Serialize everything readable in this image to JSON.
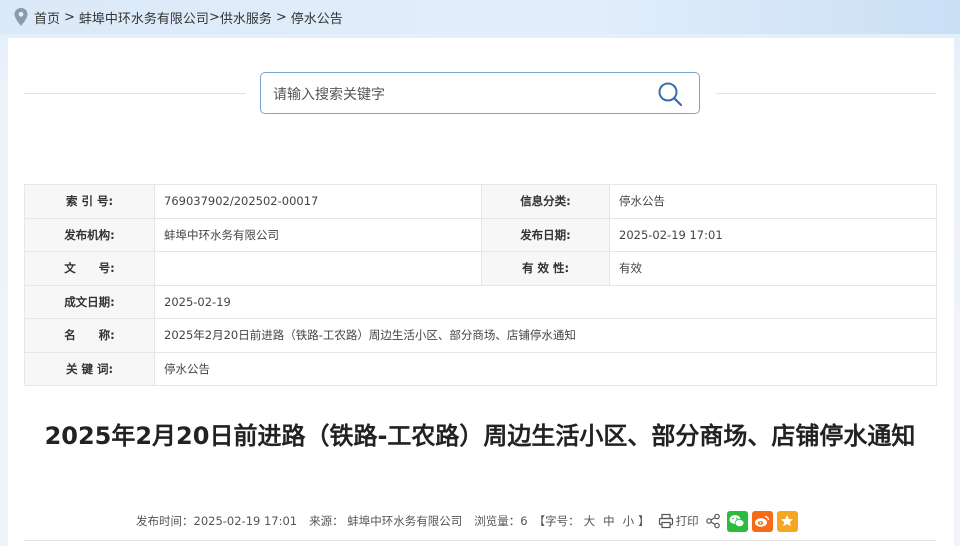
{
  "breadcrumb": {
    "items": [
      "首页",
      "蚌埠中环水务有限公司",
      "供水服务",
      "停水公告"
    ],
    "separators": [
      " > ",
      ">",
      " > "
    ]
  },
  "search": {
    "placeholder": "请输入搜索关键字",
    "value": ""
  },
  "meta_table": {
    "rows": [
      {
        "label1": "索 引 号:",
        "value1": "769037902/202502-00017",
        "label2": "信息分类:",
        "value2": "停水公告"
      },
      {
        "label1": "发布机构:",
        "value1": "蚌埠中环水务有限公司",
        "label2": "发布日期:",
        "value2": "2025-02-19 17:01"
      },
      {
        "label1": "文　　号:",
        "value1": "",
        "label2": "有 效 性:",
        "value2": "有效"
      },
      {
        "label1": "成文日期:",
        "value1": "2025-02-19"
      },
      {
        "label1": "名　　称:",
        "value1": "2025年2月20日前进路（铁路-工农路）周边生活小区、部分商场、店铺停水通知"
      },
      {
        "label1": "关 键 词:",
        "value1": "停水公告"
      }
    ]
  },
  "article": {
    "title": "2025年2月20日前进路（铁路-工农路）周边生活小区、部分商场、店铺停水通知",
    "publish_time": "发布时间：2025-02-19 17:01",
    "source": "来源： 蚌埠中环水务有限公司",
    "views": "浏览量：6",
    "font_size_open": "【字号：",
    "font_sizes": [
      "大",
      "中",
      "小"
    ],
    "font_size_close": "】",
    "print_label": "打印"
  },
  "colors": {
    "accent": "#7aa5cf",
    "wechat": "#2dbb3c",
    "weibo": "#f56b17",
    "favorite": "#f5a623"
  },
  "icons": [
    "location-pin-icon",
    "search-icon",
    "printer-icon",
    "share-icon",
    "wechat-icon",
    "weibo-icon",
    "star-icon"
  ]
}
